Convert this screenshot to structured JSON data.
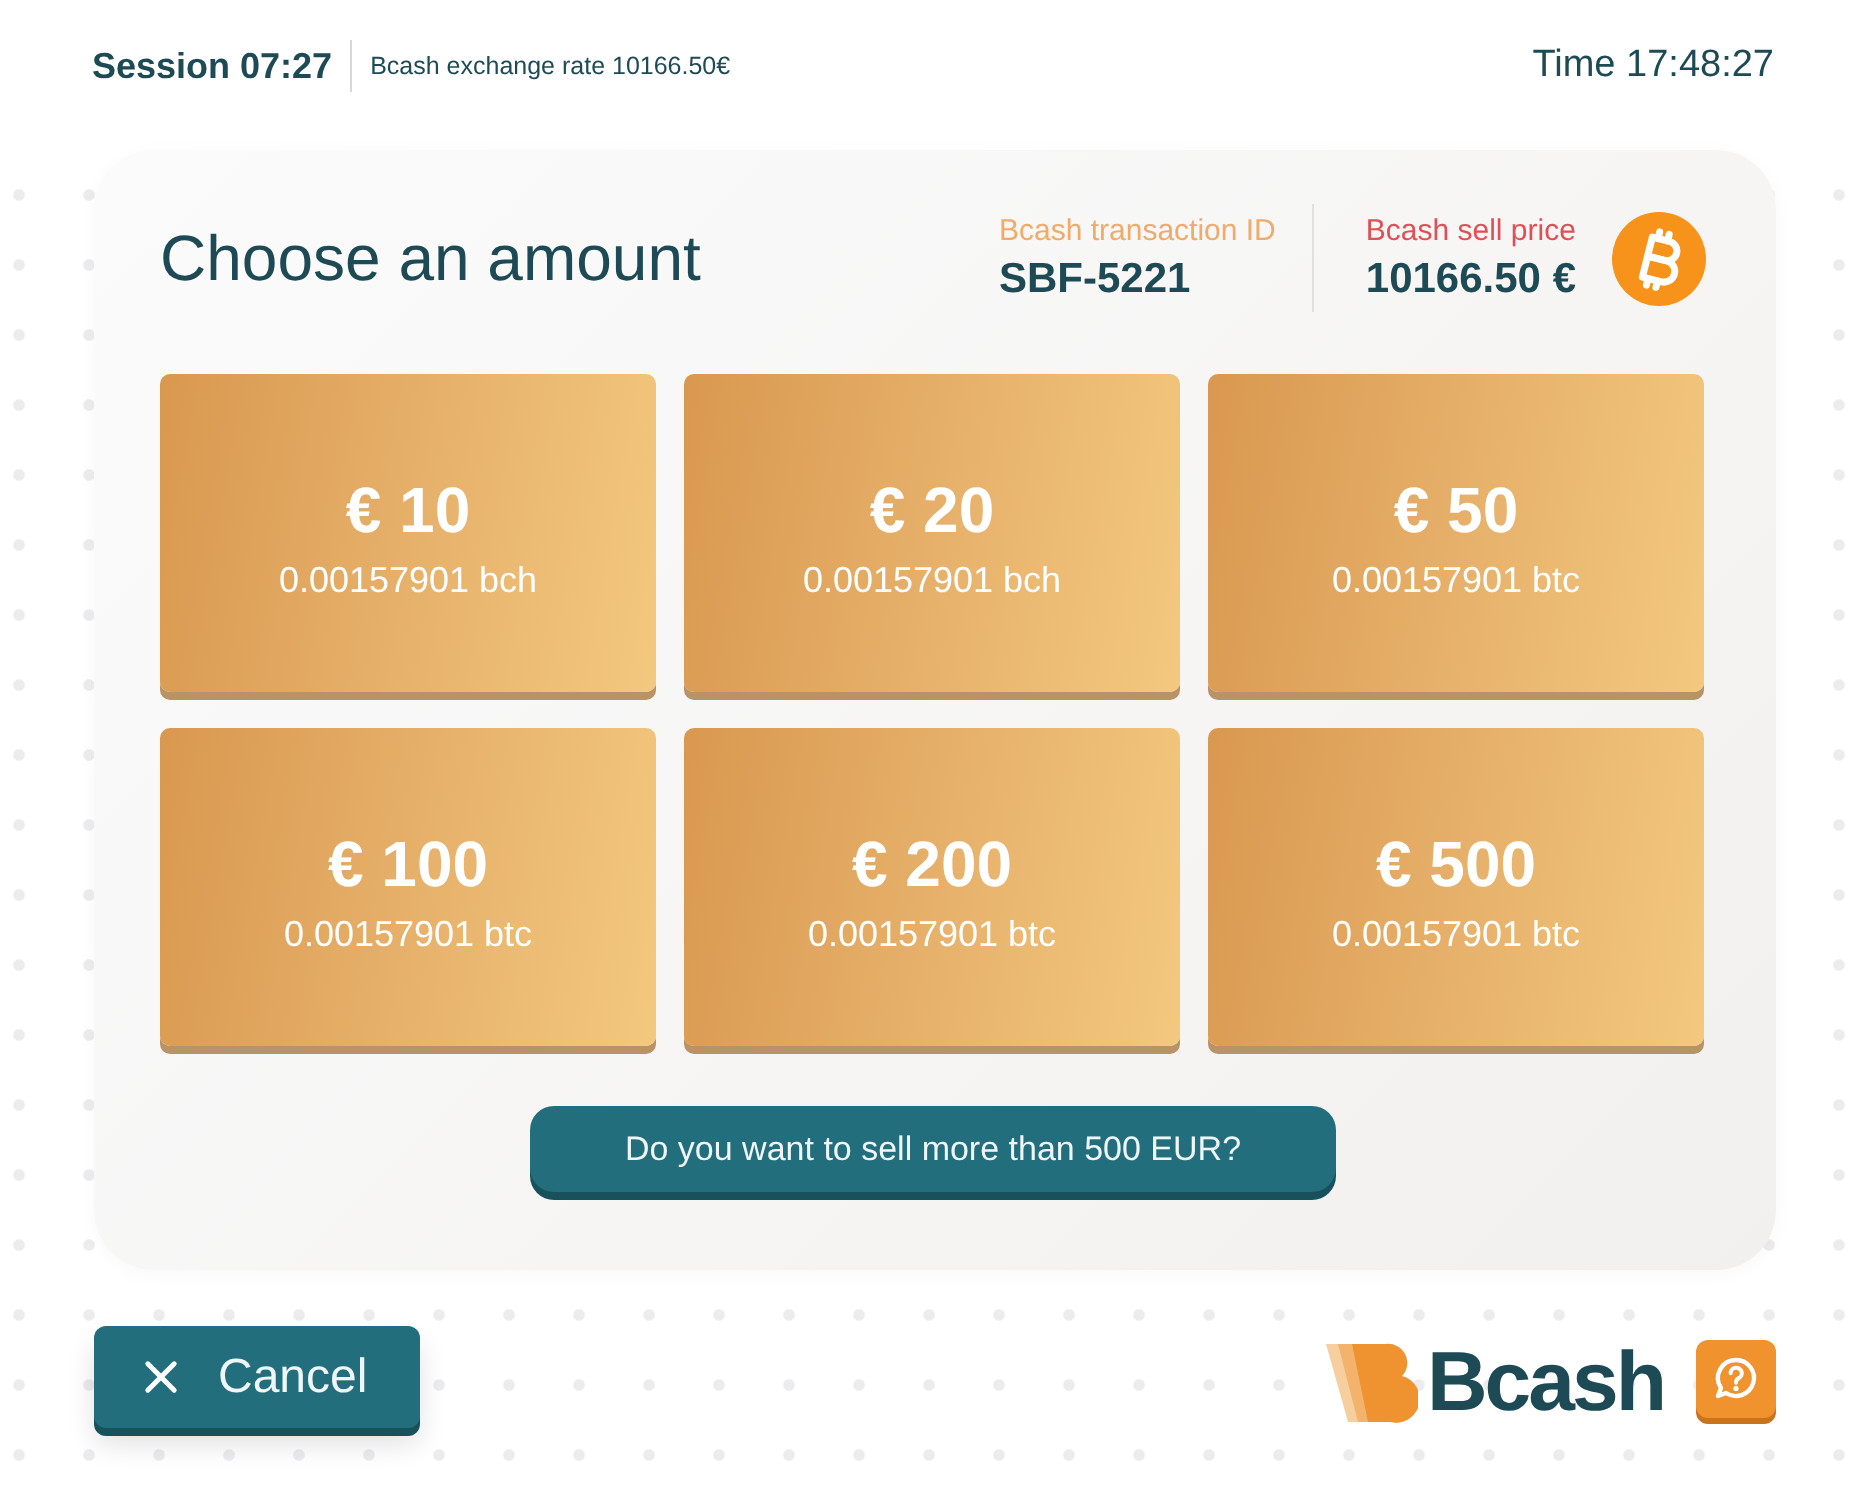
{
  "header": {
    "session": "Session 07:27",
    "exchange_rate": "Bcash exchange rate 10166.50€",
    "time": "Time 17:48:27"
  },
  "panel": {
    "title": "Choose an amount",
    "transaction": {
      "label": "Bcash transaction ID",
      "value": "SBF-5221"
    },
    "sell_price": {
      "label": "Bcash sell price",
      "value": "10166.50 €"
    }
  },
  "amounts": [
    {
      "amount": "€ 10",
      "crypto": "0.00157901 bch"
    },
    {
      "amount": "€ 20",
      "crypto": "0.00157901 bch"
    },
    {
      "amount": "€ 50",
      "crypto": "0.00157901 btc"
    },
    {
      "amount": "€ 100",
      "crypto": "0.00157901 btc"
    },
    {
      "amount": "€ 200",
      "crypto": "0.00157901 btc"
    },
    {
      "amount": "€ 500",
      "crypto": "0.00157901 btc"
    }
  ],
  "more_button": "Do you want to sell more than 500 EUR?",
  "footer": {
    "cancel_button": "Cancel",
    "logo": "Bcash"
  }
}
